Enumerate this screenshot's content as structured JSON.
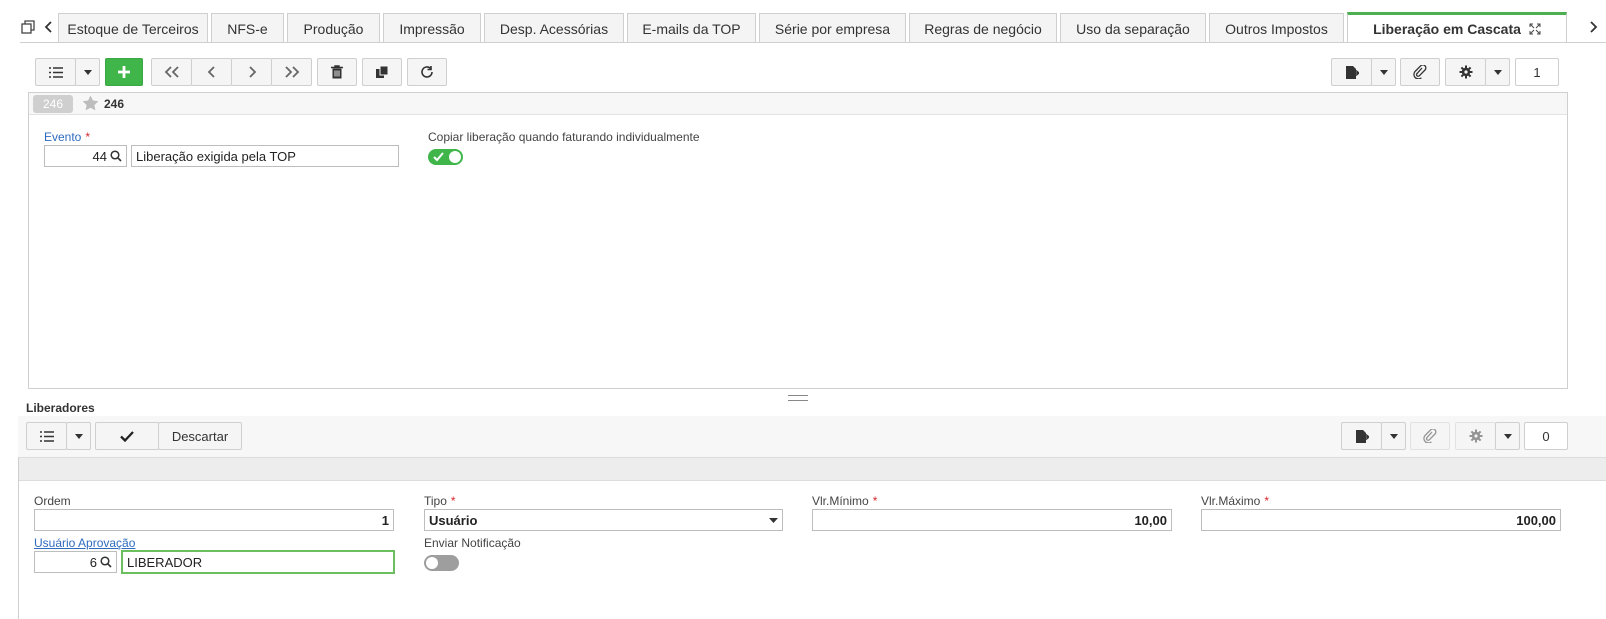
{
  "tabs": [
    {
      "label": "Estoque de Terceiros"
    },
    {
      "label": "NFS-e"
    },
    {
      "label": "Produção"
    },
    {
      "label": "Impressão"
    },
    {
      "label": "Desp. Acessórias"
    },
    {
      "label": "E-mails da TOP"
    },
    {
      "label": "Série por empresa"
    },
    {
      "label": "Regras de negócio"
    },
    {
      "label": "Uso da separação"
    },
    {
      "label": "Outros Impostos"
    },
    {
      "label": "Liberação em Cascata",
      "active": true
    }
  ],
  "top": {
    "page_count": "1",
    "record_badge": "246",
    "record_title": "246",
    "evento_label": "Evento",
    "evento_code": "44",
    "evento_desc": "Liberação exigida pela TOP",
    "copiar_label": "Copiar liberação quando faturando individualmente",
    "copiar_on": true
  },
  "liberadores": {
    "title": "Liberadores",
    "discard_label": "Descartar",
    "page_count": "0",
    "ordem_label": "Ordem",
    "ordem_value": "1",
    "tipo_label": "Tipo",
    "tipo_value": "Usuário",
    "vlr_min_label": "Vlr.Mínimo",
    "vlr_min_value": "10,00",
    "vlr_max_label": "Vlr.Máximo",
    "vlr_max_value": "100,00",
    "usuario_label": "Usuário Aprovação",
    "usuario_code": "6",
    "usuario_name": "LIBERADOR",
    "notif_label": "Enviar Notificação",
    "notif_on": false
  },
  "colors": {
    "accent": "#4caf50",
    "link": "#2f6bbf",
    "required": "#d9262c"
  }
}
